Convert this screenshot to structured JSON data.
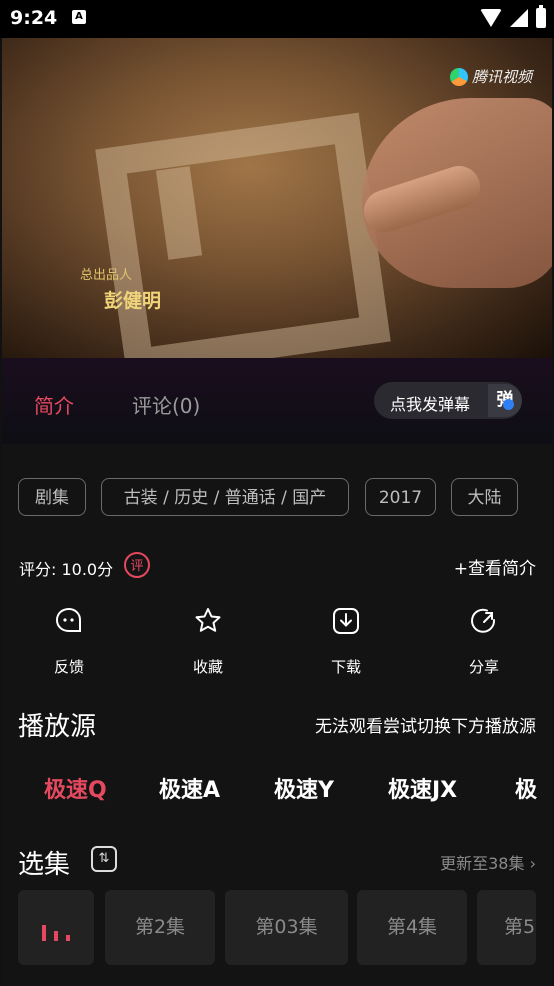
{
  "status_bar": {
    "time": "9:24",
    "notification_icon": "A"
  },
  "video": {
    "watermark": "腾讯视频",
    "credit_role": "总出品人",
    "credit_name": "彭健明"
  },
  "tabs": [
    {
      "label": "简介",
      "active": true
    },
    {
      "label": "评论(0)",
      "active": false
    }
  ],
  "danmaku": {
    "label": "点我发弹幕",
    "icon_text": "弹"
  },
  "tags": [
    "剧集",
    "古装 / 历史 / 普通话 / 国产",
    "2017",
    "大陆"
  ],
  "rating": {
    "text": "评分: 10.0分",
    "badge": "评"
  },
  "more_intro": "+查看简介",
  "actions": [
    {
      "label": "反馈",
      "icon": "feedback-icon"
    },
    {
      "label": "收藏",
      "icon": "star-icon"
    },
    {
      "label": "下载",
      "icon": "download-icon"
    },
    {
      "label": "分享",
      "icon": "share-icon"
    }
  ],
  "sources": {
    "title": "播放源",
    "hint": "无法观看尝试切换下方播放源",
    "items": [
      "极速Q",
      "极速A",
      "极速Y",
      "极速JX",
      "极"
    ],
    "active_index": 0
  },
  "episodes": {
    "title": "选集",
    "update": "更新至38集",
    "items": [
      "",
      "第2集",
      "第03集",
      "第4集",
      "第5"
    ]
  },
  "colors": {
    "accent": "#e5495f",
    "background": "#131313"
  }
}
